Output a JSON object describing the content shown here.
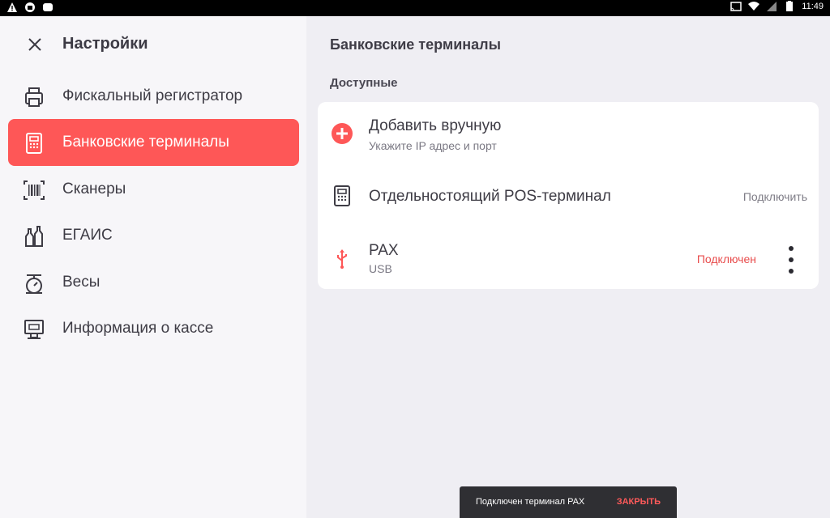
{
  "statusbar": {
    "time": "11:49",
    "battery_level": "1"
  },
  "sidebar": {
    "title": "Настройки",
    "items": [
      {
        "label": "Фискальный регистратор",
        "icon": "printer-icon"
      },
      {
        "label": "Банковские терминалы",
        "icon": "pos-terminal-icon",
        "active": true
      },
      {
        "label": "Сканеры",
        "icon": "barcode-icon"
      },
      {
        "label": "ЕГАИС",
        "icon": "bottles-icon"
      },
      {
        "label": "Весы",
        "icon": "scales-icon"
      },
      {
        "label": "Информация о кассе",
        "icon": "monitor-icon"
      }
    ]
  },
  "main": {
    "title": "Банковские терминалы",
    "section": "Доступные",
    "rows": [
      {
        "title": "Добавить вручную",
        "subtitle": "Укажите IP адрес и порт",
        "icon": "add-circle-icon"
      },
      {
        "title": "Отдельностоящий POS-терминал",
        "action": "Подключить",
        "icon": "pos-terminal-icon"
      },
      {
        "title": "PAX",
        "subtitle": "USB",
        "status": "Подключен",
        "icon": "usb-icon"
      }
    ]
  },
  "snackbar": {
    "message": "Подключен терминал PAX",
    "action": "ЗАКРЫТЬ"
  },
  "colors": {
    "accent": "#fe5757",
    "status_connected": "#e84c4c"
  }
}
